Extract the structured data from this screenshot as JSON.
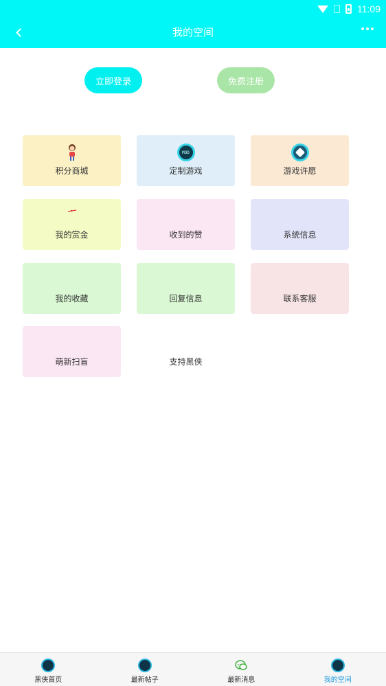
{
  "status_bar": {
    "time": "11:09"
  },
  "header": {
    "title": "我的空间"
  },
  "actions": {
    "login": "立即登录",
    "register": "免费注册"
  },
  "grid": {
    "items": [
      {
        "label": "积分商城",
        "icon": "girl-icon",
        "bg": "#fbf1c4"
      },
      {
        "label": "定制游戏",
        "icon": "mod-game-icon",
        "bg": "#dfeef8"
      },
      {
        "label": "游戏许愿",
        "icon": "wish-icon",
        "bg": "#fbe9d4"
      },
      {
        "label": "我的赏金",
        "icon": "arrow-icon",
        "bg": "#f5fbc4"
      },
      {
        "label": "收到的赞",
        "icon": "",
        "bg": "#fbe6f3"
      },
      {
        "label": "系统信息",
        "icon": "",
        "bg": "#e2e4fa"
      },
      {
        "label": "我的收藏",
        "icon": "",
        "bg": "#d9f8d3"
      },
      {
        "label": "回复信息",
        "icon": "",
        "bg": "#d9f8d3"
      },
      {
        "label": "联系客服",
        "icon": "",
        "bg": "#f8e3e5"
      },
      {
        "label": "萌新扫盲",
        "icon": "",
        "bg": "#fbe6f3"
      },
      {
        "label": "支持黑侠",
        "icon": "",
        "bg": "#ffffff"
      }
    ]
  },
  "mod_icon_text": "MOD",
  "bottom_nav": {
    "items": [
      {
        "label": "黑侠首页",
        "active": false
      },
      {
        "label": "最新帖子",
        "active": false
      },
      {
        "label": "最新消息",
        "active": false
      },
      {
        "label": "我的空间",
        "active": true
      }
    ]
  },
  "colors": {
    "primary": "#00f7f7",
    "register": "#a9e5a6",
    "active_tab": "#1e9be0"
  }
}
